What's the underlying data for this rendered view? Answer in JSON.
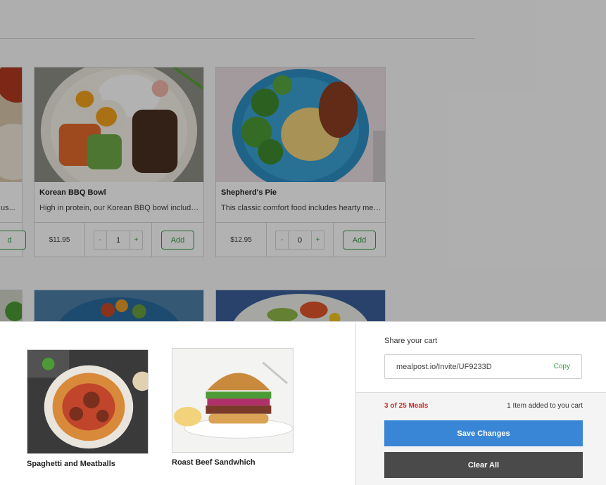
{
  "menu": {
    "cards": [
      {
        "title": "Korean BBQ Bowl",
        "description": "High in protein, our Korean BBQ bowl includes a generous portion of marinated beef",
        "price": "$11.95",
        "quantity": "1",
        "minus": "-",
        "plus": "+",
        "add_label": "Add"
      },
      {
        "title": "Shepherd's Pie",
        "description": "This classic comfort food includes hearty meat and vegetables topped with mashed potato",
        "price": "$12.95",
        "quantity": "0",
        "minus": "-",
        "plus": "+",
        "add_label": "Add"
      }
    ],
    "partial_left": {
      "description_tail": "us...",
      "add_label": "d"
    }
  },
  "cart": {
    "items": [
      {
        "name": "Spaghetti and Meatballs",
        "image_icon": "spaghetti-plate-image"
      },
      {
        "name": "Roast Beef Sandwhich",
        "image_icon": "burger-image"
      }
    ],
    "share": {
      "label": "Share your cart",
      "url": "mealpost.io/Invite/UF9233D",
      "copy_label": "Copy"
    },
    "meal_count": "3 of 25 Meals",
    "added_note": "1 Item added to you cart",
    "save_label": "Save Changes",
    "clear_label": "Clear All"
  },
  "colors": {
    "accent_green": "#3a9a4a",
    "save_blue": "#3a86d6",
    "clear_dark": "#4a4a4a",
    "count_red": "#c8332b"
  }
}
